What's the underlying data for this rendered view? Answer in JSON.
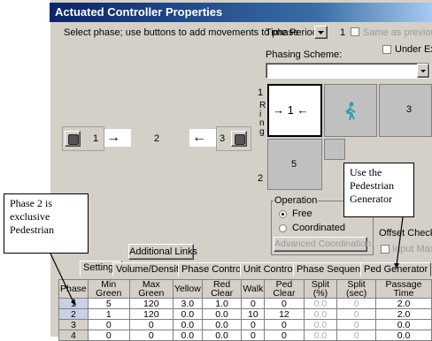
{
  "window": {
    "title": "Actuated Controller Properties",
    "instruction": "Select phase; use buttons to add movements to phase"
  },
  "time_period": {
    "label": "Time Period:",
    "value": "1",
    "same_as_previous": "Same as previous"
  },
  "phasing": {
    "label": "Phasing Scheme:",
    "under_ext": "Under Ext"
  },
  "phase_row": [
    {
      "label": "1",
      "arrow": "→"
    },
    {
      "label": "2"
    },
    {
      "label": "3",
      "arrow": "←"
    }
  ],
  "ring": {
    "label": "Ring",
    "top_number": "1",
    "bottom_number": "2",
    "cell1_label": "1",
    "cell1_arrows": "→  ←",
    "cell3_label": "3",
    "cell5_label": "5"
  },
  "operation": {
    "label": "Operation",
    "free": "Free",
    "coordinated": "Coordinated",
    "advanced": "Advanced Coordination",
    "offset_check": "Offset Check",
    "input_max": "Input Max"
  },
  "additional_links": "Additional Links",
  "tabs": [
    "Settings",
    "Volume/Density",
    "Phase Controls",
    "Unit Controls",
    "Phase Sequence",
    "Ped Generator"
  ],
  "table": {
    "headers": [
      "Phase",
      "Min Green",
      "Max Green",
      "Yellow",
      "Red Clear",
      "Walk",
      "Ped Clear",
      "Split (%)",
      "Split (sec)",
      "Passage Time"
    ],
    "rows": [
      [
        "1",
        "5",
        "120",
        "3.0",
        "1.0",
        "0",
        "0",
        "0.0",
        "0",
        "2.0"
      ],
      [
        "2",
        "1",
        "120",
        "0.0",
        "0.0",
        "10",
        "12",
        "0.0",
        "0",
        "2.0"
      ],
      [
        "3",
        "0",
        "0",
        "0.0",
        "0.0",
        "0",
        "0",
        "0.0",
        "0",
        "0.0"
      ],
      [
        "4",
        "0",
        "0",
        "0.0",
        "0.0",
        "0",
        "0",
        "0.0",
        "0",
        "0.0"
      ]
    ]
  },
  "callouts": {
    "phase2": "Phase 2 is exclusive Pedestrian",
    "ped_generator": "Use the Pedestrian Generator"
  },
  "colors": {
    "title_start": "#0a246a",
    "title_end": "#a6caf0",
    "ped_icon": "#2aa0a8"
  }
}
